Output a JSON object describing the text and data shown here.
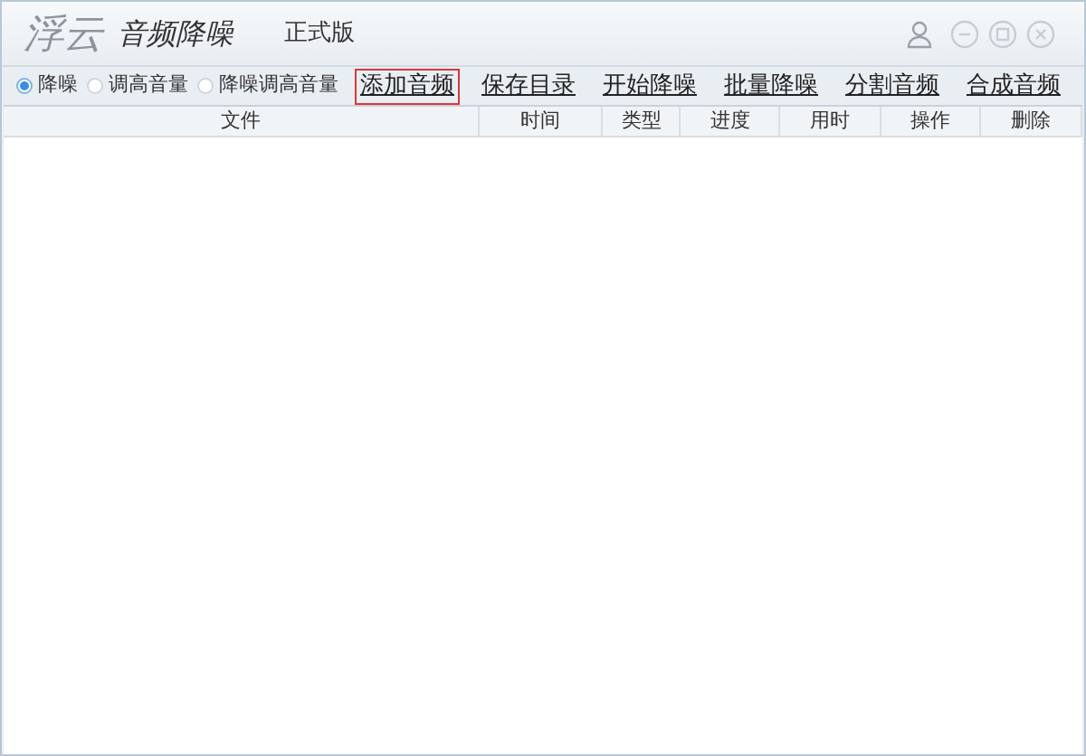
{
  "window": {
    "logo": "浮云",
    "title": "音频降噪",
    "edition": "正式版"
  },
  "modes": [
    {
      "label": "降噪",
      "selected": true
    },
    {
      "label": "调高音量",
      "selected": false
    },
    {
      "label": "降噪调高音量",
      "selected": false
    }
  ],
  "actions": [
    {
      "label": "添加音频",
      "selected": true
    },
    {
      "label": "保存目录",
      "selected": false
    },
    {
      "label": "开始降噪",
      "selected": false
    },
    {
      "label": "批量降噪",
      "selected": false
    },
    {
      "label": "分割音频",
      "selected": false
    },
    {
      "label": "合成音频",
      "selected": false
    }
  ],
  "table": {
    "columns": [
      "文件",
      "时间",
      "类型",
      "进度",
      "用时",
      "操作",
      "删除"
    ]
  }
}
